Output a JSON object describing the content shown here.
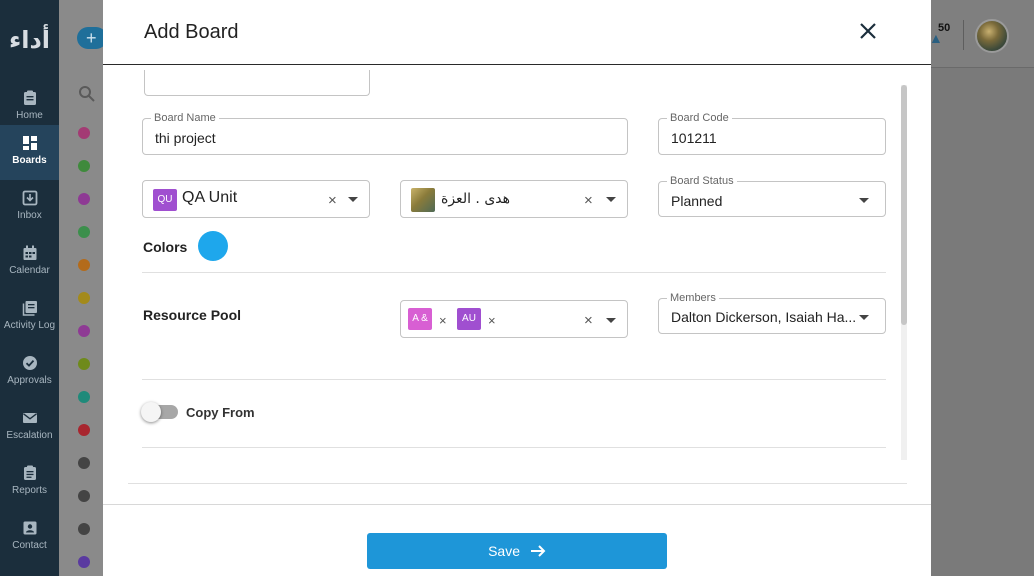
{
  "sidebar": {
    "logo": "أداء",
    "items": [
      {
        "label": "Home",
        "icon": "clipboard-icon",
        "active": false
      },
      {
        "label": "Boards",
        "icon": "boards-grid-icon",
        "active": true
      },
      {
        "label": "Inbox",
        "icon": "inbox-icon",
        "active": false
      },
      {
        "label": "Calendar",
        "icon": "calendar-icon",
        "active": false
      },
      {
        "label": "Activity Log",
        "icon": "activity-log-icon",
        "active": false
      },
      {
        "label": "Approvals",
        "icon": "check-circle-icon",
        "active": false
      },
      {
        "label": "Escalation",
        "icon": "mail-icon",
        "active": false
      },
      {
        "label": "Reports",
        "icon": "report-icon",
        "active": false
      },
      {
        "label": "Contact",
        "icon": "contact-card-icon",
        "active": false
      }
    ]
  },
  "background": {
    "fab_label": "+",
    "notification_count": "50",
    "list_dot_colors": [
      "#a33b74",
      "#3f8a3c",
      "#8e3a94",
      "#3c8f4c",
      "#b36b1b",
      "#a38a1b",
      "#8e3a94",
      "#6f8a1b",
      "#1f8a7a",
      "#a8262f",
      "#444444",
      "#444444",
      "#444444",
      "#5a3aa0"
    ]
  },
  "modal": {
    "title": "Add Board",
    "board_name": {
      "label": "Board Name",
      "value": "thi project"
    },
    "board_code": {
      "label": "Board Code",
      "value": "101211"
    },
    "unit": {
      "chip": "QU",
      "value": "QA Unit",
      "chip_color": "#a04fd0"
    },
    "owner": {
      "value": "هدى . العزة"
    },
    "board_status": {
      "label": "Board Status",
      "value": "Planned"
    },
    "colors_label": "Colors",
    "selected_color": "#1ea7ec",
    "resource_pool": {
      "label": "Resource Pool",
      "chips": [
        {
          "text": "A &",
          "color": "#d85fd3"
        },
        {
          "text": "AU",
          "color": "#a04fd0"
        }
      ]
    },
    "members": {
      "label": "Members",
      "value": "Dalton Dickerson, Isaiah Ha..."
    },
    "copy_from_label": "Copy From",
    "save_label": "Save"
  }
}
